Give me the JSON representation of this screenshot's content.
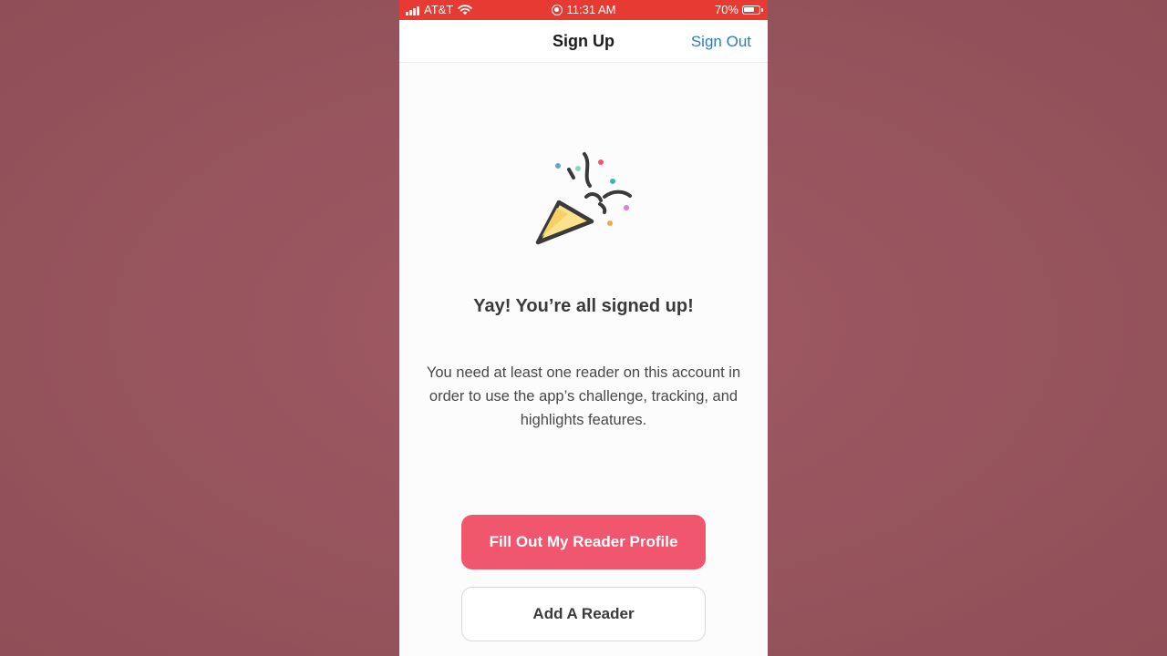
{
  "status_bar": {
    "carrier": "AT&T",
    "time": "11:31 AM",
    "battery": "70%"
  },
  "nav": {
    "title": "Sign Up",
    "action": "Sign Out"
  },
  "content": {
    "heading": "Yay! You’re all signed up!",
    "body": "You need at least one reader on this account in order to use the app’s challenge, tracking, and highlights features."
  },
  "buttons": {
    "primary": "Fill Out My Reader Profile",
    "secondary": "Add A Reader"
  },
  "colors": {
    "status_bar": "#e63a32",
    "primary_button": "#f0566e",
    "link": "#2b7bbf",
    "backdrop": "#9a5660"
  }
}
